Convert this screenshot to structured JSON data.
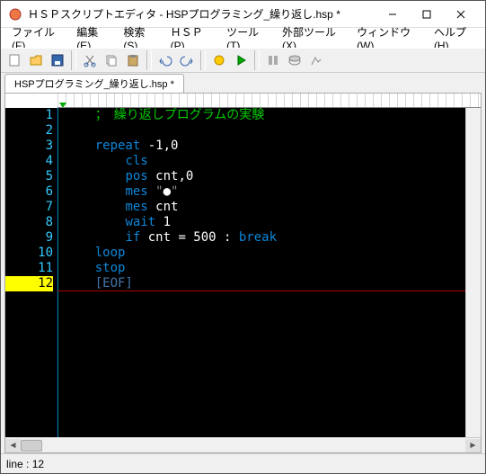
{
  "window": {
    "title": "ＨＳＰスクリプトエディタ - HSPプログラミング_繰り返し.hsp *"
  },
  "menu": {
    "file": "ファイル(F)",
    "edit": "編集(E)",
    "search": "検索(S)",
    "hsp": "ＨＳＰ(P)",
    "tool": "ツール(T)",
    "ext": "外部ツール(X)",
    "win": "ウィンドウ(W)",
    "help": "ヘルプ(H)"
  },
  "tab": {
    "label": "HSPプログラミング_繰り返し.hsp *"
  },
  "gutter": {
    "lines": [
      "1",
      "2",
      "3",
      "4",
      "5",
      "6",
      "7",
      "8",
      "9",
      "10",
      "11",
      "12"
    ],
    "current": 12
  },
  "code": {
    "l1_comment": "；　繰り返しプログラムの実験",
    "l2": "",
    "l3_kw": "repeat",
    "l3_args": " -1,0",
    "l4_fn": "cls",
    "l5_fn": "pos",
    "l5_args": " cnt,0",
    "l6_fn": "mes",
    "l6_q": " \"",
    "l6_bullet": "●",
    "l6_q2": "\"",
    "l7_fn": "mes",
    "l7_args": " cnt",
    "l8_fn": "wait",
    "l8_args": " 1",
    "l9_kw": "if",
    "l9_mid": " cnt = 500 : ",
    "l9_kw2": "break",
    "l10_kw": "loop",
    "l11_kw": "stop",
    "l12_eof": "[EOF]"
  },
  "status": {
    "line_prefix": "line :",
    "line_no": "12"
  }
}
